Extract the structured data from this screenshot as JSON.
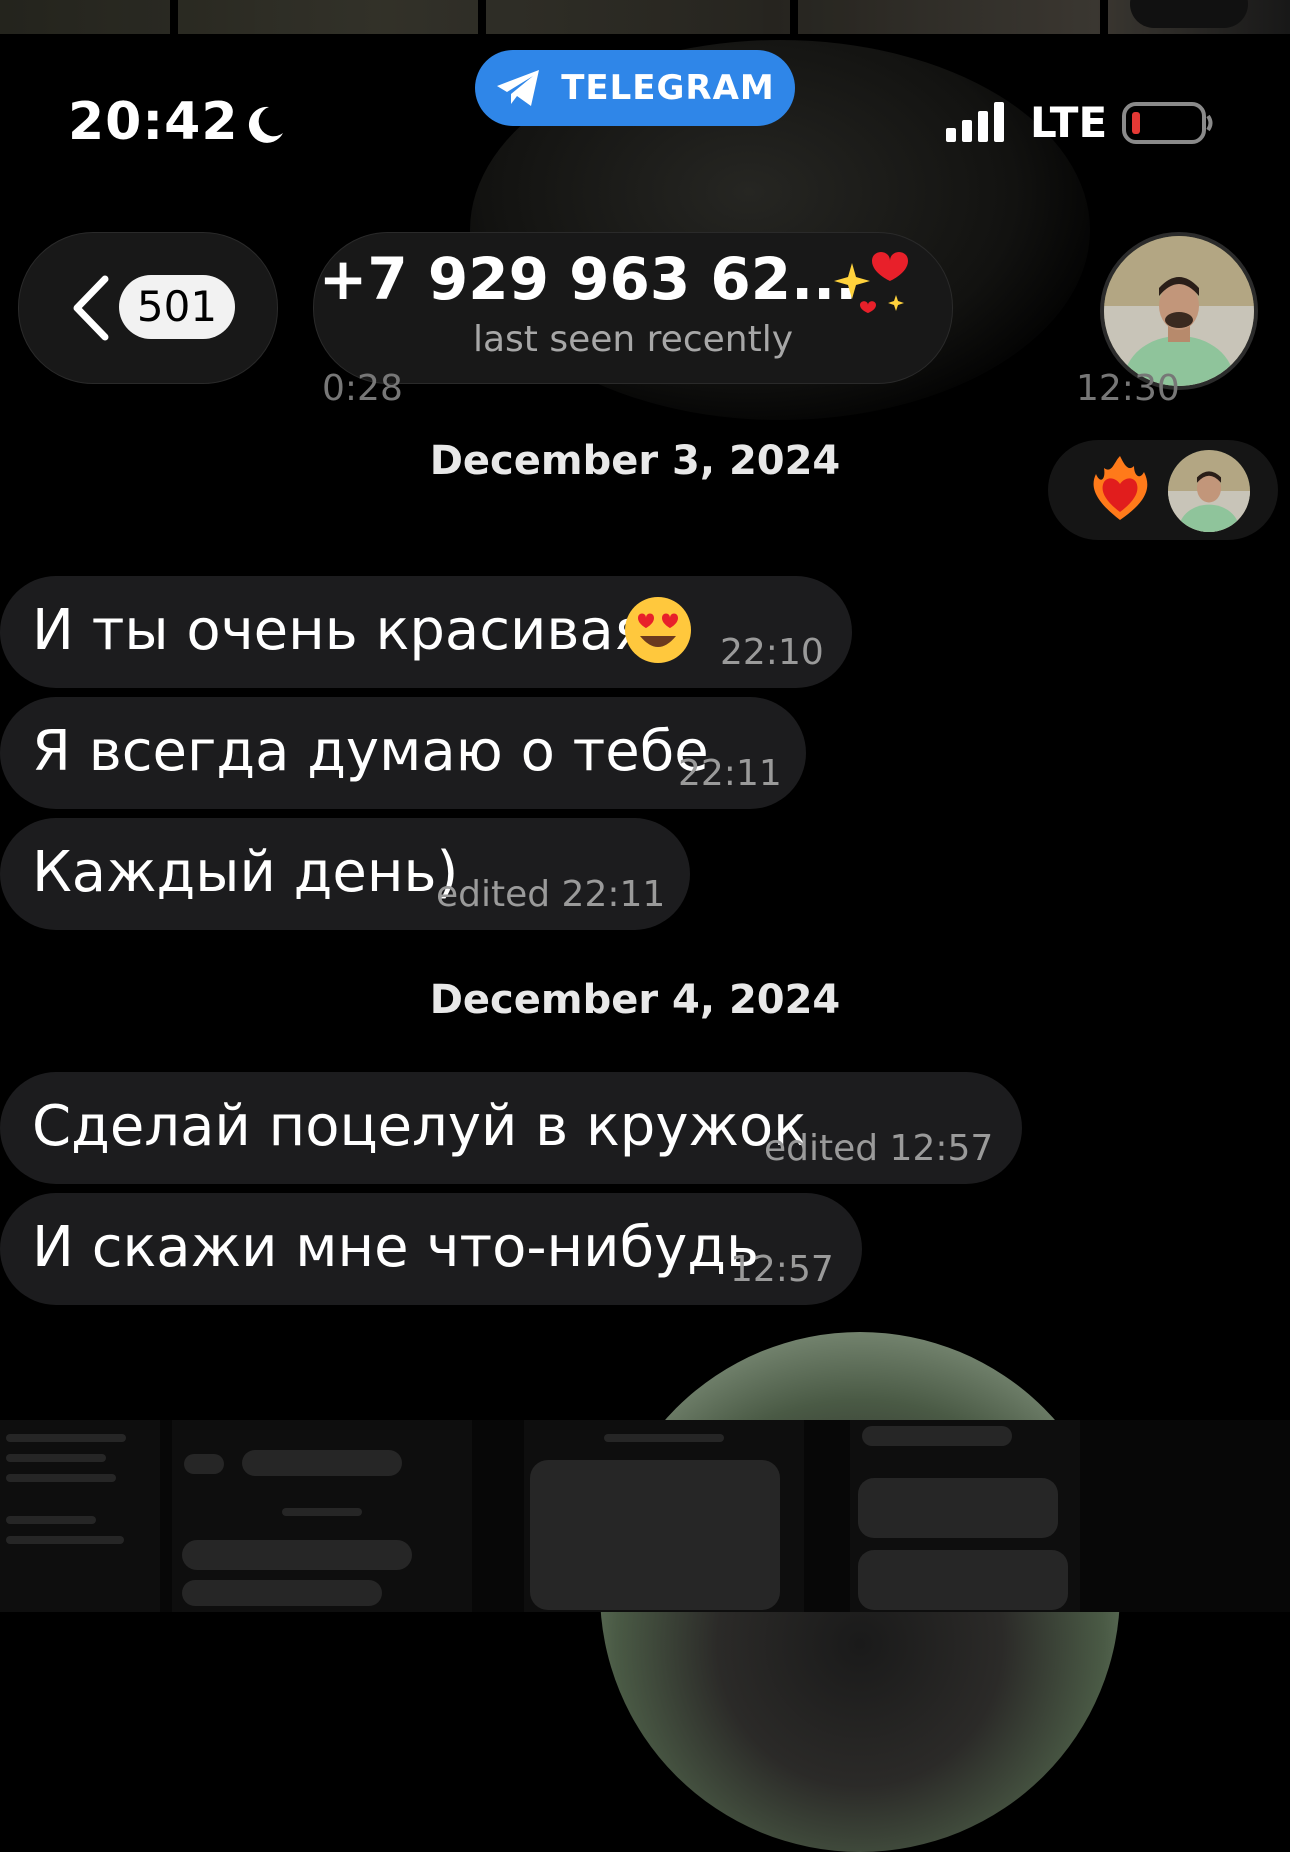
{
  "status_bar": {
    "time": "20:42",
    "app_pill": "TELEGRAM",
    "network": "LTE"
  },
  "header": {
    "unread_count": "501",
    "contact_name": "+7 929 963 62...",
    "last_seen": "last seen recently"
  },
  "ghost_times": {
    "left": "0:28",
    "right": "12:30"
  },
  "dates": [
    "December 3, 2024",
    "December 4, 2024"
  ],
  "messages": [
    {
      "text": "И ты очень красивая",
      "time": "22:10"
    },
    {
      "text": "Я всегда думаю о тебе",
      "time": "22:11"
    },
    {
      "text": "Каждый день)",
      "time": "edited 22:11"
    },
    {
      "text": "Сделай поцелуй в кружок",
      "time": "edited 12:57"
    },
    {
      "text": "И скажи мне что-нибудь",
      "time": "12:57"
    }
  ],
  "colors": {
    "background": "#000000",
    "bubble": "#1c1c1e",
    "telegram_blue": "#2f86e8",
    "battery_low": "#e53935"
  }
}
